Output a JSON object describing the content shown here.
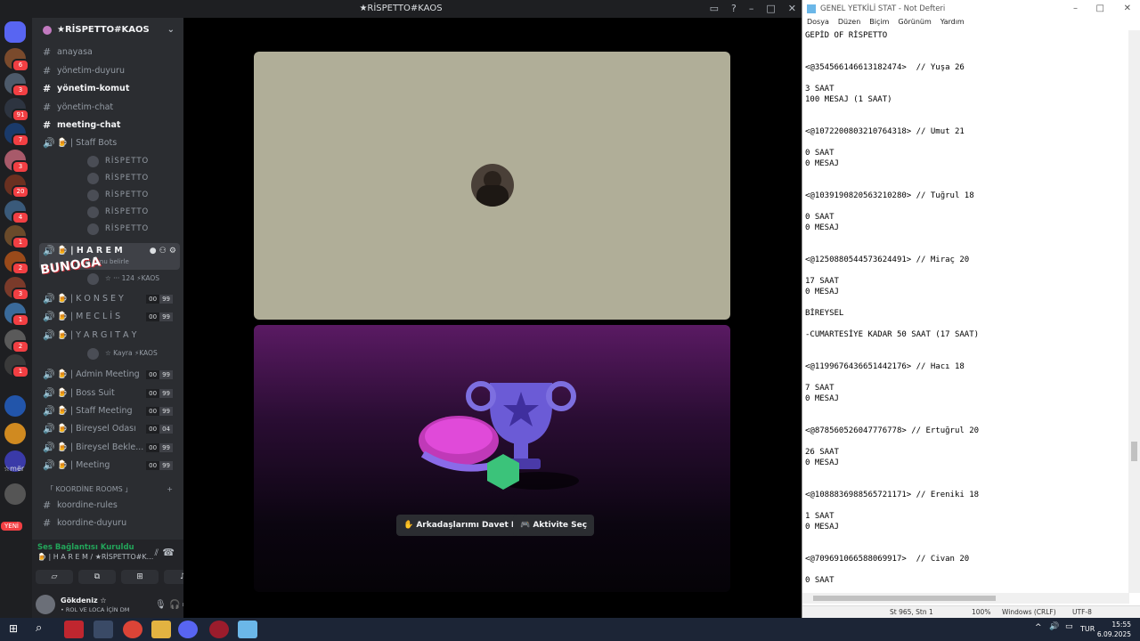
{
  "discord": {
    "window_title": "★RİSPETTO#KAOS",
    "server_name": "★RİSPETTO#KAOS",
    "servers": [
      {
        "badge": "6"
      },
      {
        "badge": "3"
      },
      {
        "badge": "91"
      },
      {
        "badge": "7"
      },
      {
        "badge": "3"
      },
      {
        "badge": "20"
      },
      {
        "badge": "4"
      },
      {
        "badge": "1"
      },
      {
        "badge": "2"
      },
      {
        "badge": "3"
      },
      {
        "badge": "1"
      },
      {
        "badge": "2"
      },
      {
        "badge": "1"
      }
    ],
    "server_label_mer": "☆mër",
    "server_label_new": "YENİ",
    "channels": {
      "anayasa": "anayasa",
      "yonetim_duyuru": "yönetim-duyuru",
      "yonetim_komut": "yönetim-komut",
      "yonetim_chat": "yönetim-chat",
      "meeting_chat": "meeting-chat",
      "staff_bots": "🍺 | Staff Bots",
      "bot_name": "RİSPETTO",
      "harem": "🍺 | H A R E M",
      "harem_topic": "Bir konu belirle",
      "harem_member": "☆ ··· 124 ⚡KAOS",
      "konsey": "🍺 | K O N S E Y",
      "meclis": "🍺 | M E C L İ S",
      "yargitay": "🍺 | Y A R G I T A Y",
      "kayra": "☆ Kayra ⚡KAOS",
      "admin_meeting": "🍺 | Admin Meeting",
      "boss_suit": "🍺 | Boss Suit",
      "staff_meeting": "🍺 | Staff Meeting",
      "bireysel_odasi": "🍺 | Bireysel Odası",
      "bireysel_bekle": "🍺 | Bireysel Bekle...",
      "meeting": "🍺 | Meeting",
      "koordine_category": "「 KOORDİNE ROOMS 」",
      "koordine_rules": "koordine-rules",
      "koordine_duyuru": "koordine-duyuru"
    },
    "counts": {
      "konsey": [
        "00",
        "99"
      ],
      "meclis": [
        "00",
        "99"
      ],
      "admin_meeting": [
        "00",
        "99"
      ],
      "boss_suit": [
        "00",
        "99"
      ],
      "staff_meeting": [
        "00",
        "99"
      ],
      "bireysel_odasi": [
        "00",
        "04"
      ],
      "bireysel_bekle": [
        "00",
        "99"
      ],
      "meeting": [
        "00",
        "99"
      ]
    },
    "sticker_text": "BUNOGA",
    "voice": {
      "status": "Ses Bağlantısı Kuruldu",
      "channel": "🍺 | H A R E M / ★RİSPETTO#K..."
    },
    "user": {
      "name": "Gökdeniz ☆",
      "status": "• ROL VE LOCA İÇİN DM"
    },
    "buttons": {
      "invite": "Arkadaşlarımı Davet Et",
      "activity": "Aktivite Seç"
    }
  },
  "notepad": {
    "title": "GENEL YETKİLİ STAT - Not Defteri",
    "menu": [
      "Dosya",
      "Düzen",
      "Biçim",
      "Görünüm",
      "Yardım"
    ],
    "lines": [
      "GEPİD OF RİSPETTO",
      "",
      "",
      "<@354566146613182474>  // Yuşa 26",
      "",
      "3 SAAT",
      "100 MESAJ (1 SAAT)",
      "",
      "",
      "<@1072200803210764318> // Umut 21",
      "",
      "0 SAAT",
      "0 MESAJ",
      "",
      "",
      "<@1039190820563210280> // Tuğrul 18",
      "",
      "0 SAAT",
      "0 MESAJ",
      "",
      "",
      "<@1250880544573624491> // Miraç 20",
      "",
      "17 SAAT",
      "0 MESAJ",
      "",
      "BİREYSEL",
      "",
      "-CUMARTESİYE KADAR 50 SAAT (17 SAAT)",
      "",
      "",
      "<@1199676436651442176> // Hacı 18",
      "",
      "7 SAAT",
      "0 MESAJ",
      "",
      "",
      "<@878560526047776778> // Ertuğrul 20",
      "",
      "26 SAAT",
      "0 MESAJ",
      "",
      "",
      "<@1088836988565721171> // Ereniki 18",
      "",
      "1 SAAT",
      "0 MESAJ",
      "",
      "",
      "<@709691066588069917>  // Civan 20",
      "",
      "0 SAAT"
    ],
    "status": {
      "pos": "St 965, Stn 1",
      "zoom": "100%",
      "eol": "Windows (CRLF)",
      "enc": "UTF-8"
    }
  },
  "taskbar": {
    "lang": "TUR",
    "time": "15:55",
    "date": "6.09.2025"
  }
}
